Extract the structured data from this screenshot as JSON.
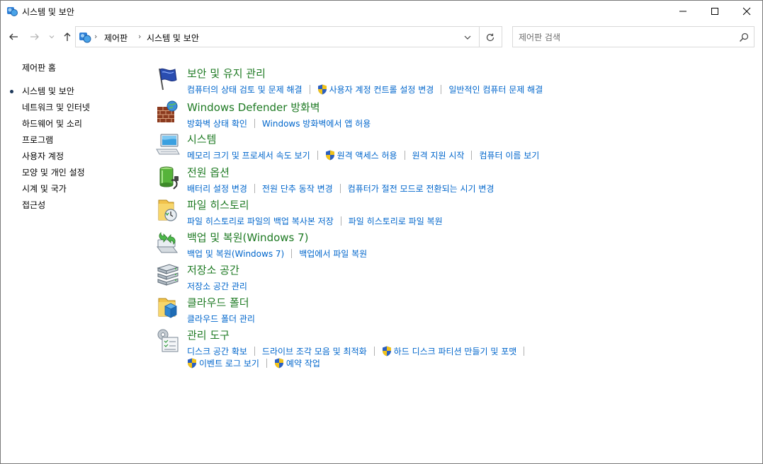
{
  "window": {
    "title": "시스템 및 보안"
  },
  "address": {
    "crumbs": [
      "제어판",
      "시스템 및 보안"
    ]
  },
  "search": {
    "placeholder": "제어판 검색"
  },
  "leftnav": {
    "home": "제어판 홈",
    "items": [
      "시스템 및 보안",
      "네트워크 및 인터넷",
      "하드웨어 및 소리",
      "프로그램",
      "사용자 계정",
      "모양 및 개인 설정",
      "시계 및 국가",
      "접근성"
    ],
    "active_index": 0
  },
  "categories": [
    {
      "title": "보안 및 유지 관리",
      "icon": "flag-icon",
      "links": [
        {
          "label": "컴퓨터의 상태 검토 및 문제 해결",
          "shield": false
        },
        {
          "label": "사용자 계정 컨트롤 설정 변경",
          "shield": true
        },
        {
          "label": "일반적인 컴퓨터 문제 해결",
          "shield": false
        }
      ]
    },
    {
      "title": "Windows Defender 방화벽",
      "icon": "firewall-icon",
      "links": [
        {
          "label": "방화벽 상태 확인",
          "shield": false
        },
        {
          "label": "Windows 방화벽에서 앱 허용",
          "shield": false
        }
      ]
    },
    {
      "title": "시스템",
      "icon": "computer-icon",
      "links": [
        {
          "label": "메모리 크기 및 프로세서 속도 보기",
          "shield": false
        },
        {
          "label": "원격 액세스 허용",
          "shield": true
        },
        {
          "label": "원격 지원 시작",
          "shield": false
        },
        {
          "label": "컴퓨터 이름 보기",
          "shield": false
        }
      ]
    },
    {
      "title": "전원 옵션",
      "icon": "battery-icon",
      "links": [
        {
          "label": "배터리 설정 변경",
          "shield": false
        },
        {
          "label": "전원 단추 동작 변경",
          "shield": false
        },
        {
          "label": "컴퓨터가 절전 모드로 전환되는 시기 변경",
          "shield": false
        }
      ]
    },
    {
      "title": "파일 히스토리",
      "icon": "file-history-icon",
      "links": [
        {
          "label": "파일 히스토리로 파일의 백업 복사본 저장",
          "shield": false
        },
        {
          "label": "파일 히스토리로 파일 복원",
          "shield": false
        }
      ]
    },
    {
      "title": "백업 및 복원(Windows 7)",
      "icon": "backup-icon",
      "links": [
        {
          "label": "백업 및 복원(Windows 7)",
          "shield": false
        },
        {
          "label": "백업에서 파일 복원",
          "shield": false
        }
      ]
    },
    {
      "title": "저장소 공간",
      "icon": "storage-icon",
      "links": [
        {
          "label": "저장소 공간 관리",
          "shield": false
        }
      ]
    },
    {
      "title": "클라우드 폴더",
      "icon": "cloud-folder-icon",
      "links": [
        {
          "label": "클라우드 폴더 관리",
          "shield": false
        }
      ]
    },
    {
      "title": "관리 도구",
      "icon": "admin-tools-icon",
      "links": [
        {
          "label": "디스크 공간 확보",
          "shield": false
        },
        {
          "label": "드라이브 조각 모음 및 최적화",
          "shield": false
        },
        {
          "label": "하드 디스크 파티션 만들기 및 포맷",
          "shield": true
        }
      ],
      "links2": [
        {
          "label": "이벤트 로그 보기",
          "shield": true
        },
        {
          "label": "예약 작업",
          "shield": true
        }
      ]
    }
  ]
}
